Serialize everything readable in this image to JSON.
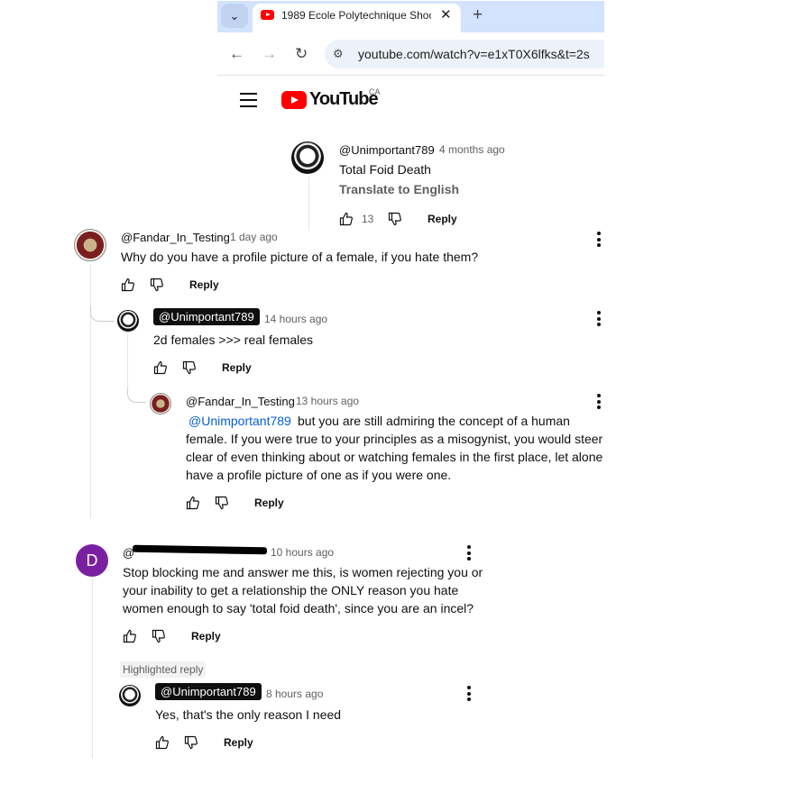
{
  "browser": {
    "tab_title": "1989 Ecole Polytechnique Shoo",
    "url": "youtube.com/watch?v=e1xT0X6lfks&t=2s",
    "icons": {
      "back": "back-arrow-icon",
      "forward": "forward-arrow-icon",
      "reload": "reload-icon",
      "site_info": "tune-icon",
      "close": "close-icon",
      "new_tab": "plus-icon",
      "tab_menu": "chevron-down-icon"
    }
  },
  "masthead": {
    "logo_text": "YouTube",
    "country": "CA"
  },
  "comments": [
    {
      "handle": "@Unimportant789",
      "time": "4 months ago",
      "text": "Total Foid Death",
      "translate": "Translate to English",
      "likes": "13",
      "reply": "Reply"
    },
    {
      "handle": "@Fandar_In_Testing",
      "time": "1 day ago",
      "text": "Why do you have a profile picture of a female, if you hate them?",
      "reply": "Reply"
    },
    {
      "handle": "@Unimportant789",
      "time": "14 hours ago",
      "text": "2d females >>> real females",
      "reply": "Reply"
    },
    {
      "handle": "@Fandar_In_Testing",
      "time": "13 hours ago",
      "mention": "@Unimportant789",
      "text_l1": "but you are still admiring the concept of a human",
      "text_l2": "female. If you were true to your principles as a misogynist, you would steer",
      "text_l3": "clear of even thinking about or watching females in the first place, let alone",
      "text_l4": "have a profile picture of one as if you were one.",
      "reply": "Reply"
    },
    {
      "avatar_letter": "D",
      "handle_visible": "@",
      "time": "10 hours ago",
      "text_l1": "Stop blocking me and answer me this, is women rejecting you or",
      "text_l2": "your inability to get a relationship the ONLY reason you hate",
      "text_l3": "women enough to say 'total foid death', since you are an incel?",
      "reply": "Reply"
    },
    {
      "badge": "Highlighted reply",
      "handle": "@Unimportant789",
      "time": "8 hours ago",
      "text": "Yes, that's the only reason I need",
      "reply": "Reply"
    }
  ]
}
